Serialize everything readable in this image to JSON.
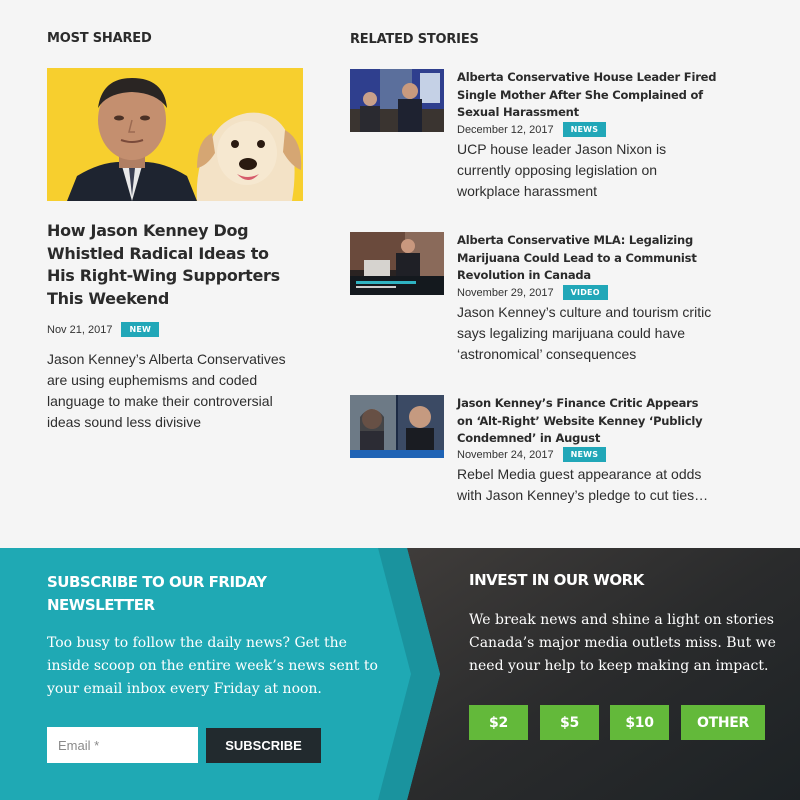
{
  "most_shared": {
    "heading": "MOST SHARED",
    "title": "How Jason Kenney Dog Whistled Radical Ideas to His Right-Wing Supporters This Weekend",
    "date": "Nov 21, 2017",
    "badge": "NEW",
    "excerpt": "Jason Kenney’s Alberta Conservatives are using euphemisms and coded language to make their controversial ideas sound less divisive"
  },
  "related": {
    "heading": "RELATED STORIES",
    "stories": [
      {
        "title": "Alberta Conservative House Leader Fired Single Mother After She Complained of Sexual Harassment",
        "date": "December 12, 2017",
        "badge": "NEWS",
        "excerpt": "UCP house leader Jason Nixon is currently opposing legislation on workplace harassment"
      },
      {
        "title": "Alberta Conservative MLA: Legalizing Marijuana Could Lead to a Communist Revolution in Canada",
        "date": "November 29, 2017",
        "badge": "VIDEO",
        "excerpt": "Jason Kenney’s culture and tourism critic says legalizing marijuana could have ‘astronomical’ consequences"
      },
      {
        "title": "Jason Kenney’s Finance Critic Appears on ‘Alt-Right’ Website Kenney ‘Publicly Condemned’ in August",
        "date": "November 24, 2017",
        "badge": "NEWS",
        "excerpt": "Rebel Media guest appearance at odds with Jason Kenney’s pledge to cut ties…"
      }
    ]
  },
  "subscribe": {
    "heading": "SUBSCRIBE TO OUR FRIDAY NEWSLETTER",
    "text": "Too busy to follow the daily news? Get the inside scoop on the entire week’s news sent to your email inbox every Friday at noon.",
    "email_placeholder": "Email *",
    "button": "SUBSCRIBE"
  },
  "invest": {
    "heading": "INVEST IN OUR WORK",
    "text": "We break news and shine a light on stories Canada’s major media outlets miss. But we need your help to keep making an impact.",
    "amounts": [
      "$2",
      "$5",
      "$10",
      "OTHER"
    ]
  },
  "colors": {
    "badge": "#21a7b8",
    "subscribe_bg": "#1fa9b4",
    "donate_green": "#63b93a",
    "dark_button": "#222a2e"
  }
}
